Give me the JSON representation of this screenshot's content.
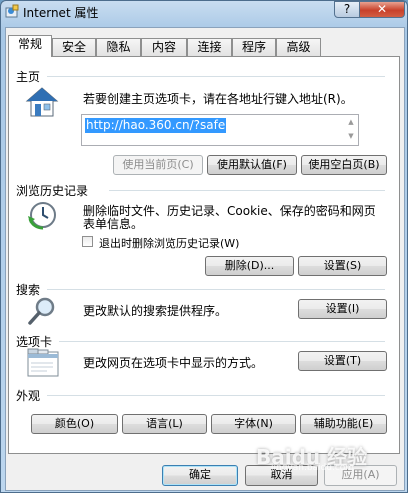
{
  "window": {
    "title": "Internet 属性",
    "help_label": "?",
    "close_label": "✕"
  },
  "tabs": [
    {
      "label": "常规",
      "active": true
    },
    {
      "label": "安全"
    },
    {
      "label": "隐私"
    },
    {
      "label": "内容"
    },
    {
      "label": "连接"
    },
    {
      "label": "程序"
    },
    {
      "label": "高级"
    }
  ],
  "home": {
    "group_label": "主页",
    "description": "若要创建主页选项卡，请在各地址行键入地址(R)。",
    "url_value": "http://hao.360.cn/?safe",
    "use_current_label": "使用当前页(C)",
    "use_default_label": "使用默认值(F)",
    "use_blank_label": "使用空白页(B)"
  },
  "history": {
    "group_label": "浏览历史记录",
    "description_line1": "删除临时文件、历史记录、Cookie、保存的密码和网页",
    "description_line2": "表单信息。",
    "delete_on_exit_label": "退出时删除浏览历史记录(W)",
    "delete_label": "删除(D)...",
    "settings_label": "设置(S)"
  },
  "search": {
    "group_label": "搜索",
    "description": "更改默认的搜索提供程序。",
    "settings_label": "设置(I)"
  },
  "tabs_section": {
    "group_label": "选项卡",
    "description": "更改网页在选项卡中显示的方式。",
    "settings_label": "设置(T)"
  },
  "appearance": {
    "group_label": "外观",
    "colors_label": "颜色(O)",
    "languages_label": "语言(L)",
    "fonts_label": "字体(N)",
    "accessibility_label": "辅助功能(E)"
  },
  "footer": {
    "ok_label": "确定",
    "cancel_label": "取消",
    "apply_label": "应用(A)"
  },
  "watermark": {
    "text": "Baidu 经验",
    "subtext": "jingyan.baidu.com"
  }
}
